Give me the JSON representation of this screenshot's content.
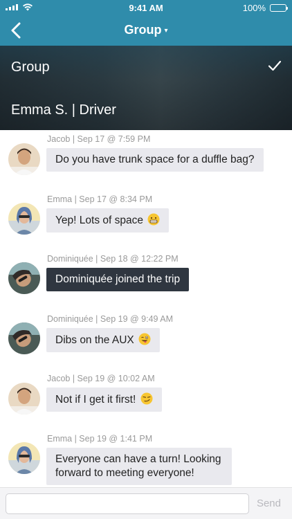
{
  "status_bar": {
    "time": "9:41 AM",
    "battery": "100%"
  },
  "nav": {
    "title": "Group",
    "caret": "▾"
  },
  "dropdown": {
    "options": [
      {
        "label": "Group",
        "selected": true
      },
      {
        "label": "Emma S. | Driver",
        "selected": false
      }
    ]
  },
  "messages": [
    {
      "meta": "Jacob | Sep 17 @ 7:59 PM",
      "text": "Do you have trunk space for a duffle bag?",
      "avatar": "jacob-avatar",
      "style": "normal"
    },
    {
      "meta": "Emma | Sep 17 @ 8:34 PM",
      "text": "Yep! Lots of space",
      "emoji": "grimacing-emoji",
      "avatar": "emma-avatar",
      "style": "normal"
    },
    {
      "meta": "Dominiquée | Sep 18 @ 12:22 PM",
      "text": "Dominiquée joined the trip",
      "avatar": "dominiquee-avatar",
      "style": "system"
    },
    {
      "meta": "Dominiquée | Sep 19 @ 9:49 AM",
      "text": "Dibs on the AUX",
      "emoji": "winking-tongue-emoji",
      "avatar": "dominiquee-avatar",
      "style": "normal"
    },
    {
      "meta": "Jacob | Sep 19 @ 10:02 AM",
      "text": "Not if I get it first!",
      "emoji": "smirk-emoji",
      "avatar": "jacob-avatar",
      "style": "normal"
    },
    {
      "meta": "Emma | Sep 19 @ 1:41 PM",
      "text": "Everyone can have a turn! Looking forward to meeting everyone!",
      "avatar": "emma-avatar",
      "style": "normal"
    }
  ],
  "composer": {
    "value": "",
    "placeholder": "",
    "send_label": "Send"
  },
  "colors": {
    "header": "#2f8cab",
    "bubble": "#e9e9ee",
    "system_bubble": "#2f3640",
    "meta_text": "#9a9a9a",
    "send_disabled": "#b9b9be"
  }
}
